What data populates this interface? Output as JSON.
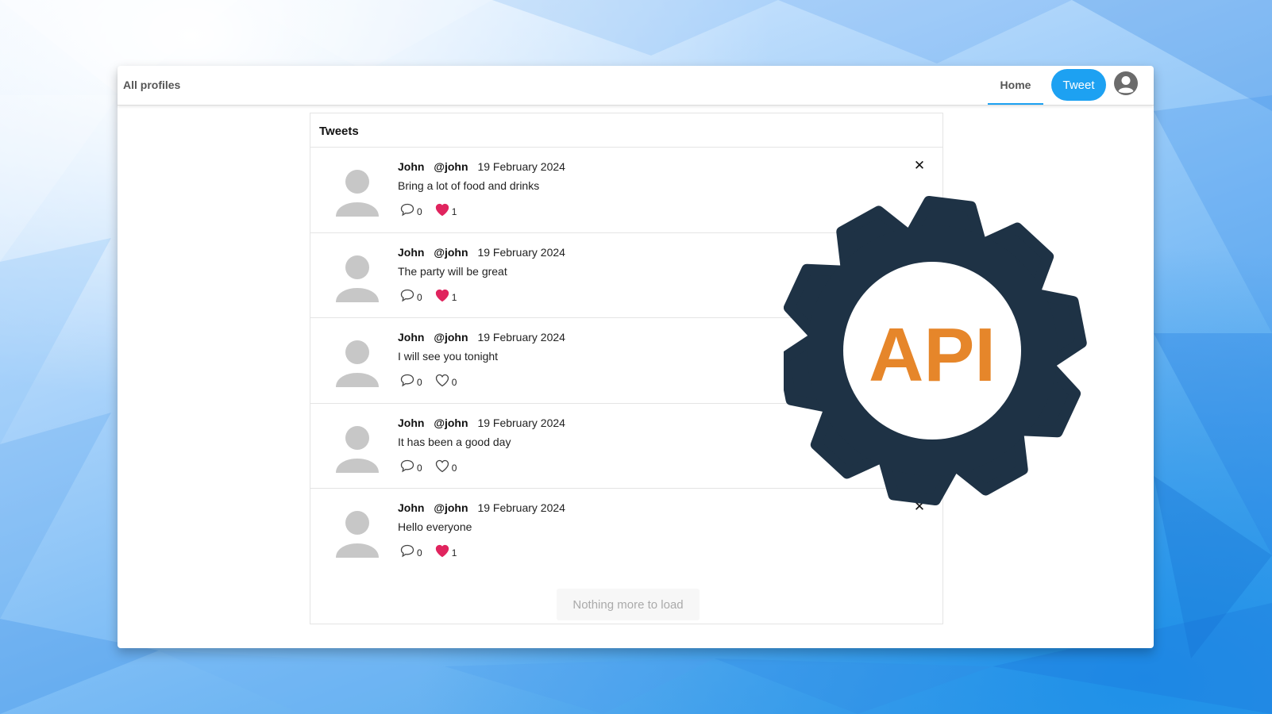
{
  "navbar": {
    "all_profiles": "All profiles",
    "home": "Home",
    "tweet_button": "Tweet",
    "avatar_icon": "user-circle-icon"
  },
  "feed": {
    "title": "Tweets",
    "load_more": "Nothing more to load",
    "tweets": [
      {
        "name": "John",
        "handle": "@john",
        "date": "19 February 2024",
        "text": "Bring a lot of food and drinks",
        "comments": "0",
        "likes": "1",
        "liked": true,
        "deletable": true
      },
      {
        "name": "John",
        "handle": "@john",
        "date": "19 February 2024",
        "text": "The party will be great",
        "comments": "0",
        "likes": "1",
        "liked": true,
        "deletable": false
      },
      {
        "name": "John",
        "handle": "@john",
        "date": "19 February 2024",
        "text": "I will see you tonight",
        "comments": "0",
        "likes": "0",
        "liked": false,
        "deletable": false
      },
      {
        "name": "John",
        "handle": "@john",
        "date": "19 February 2024",
        "text": "It has been a good day",
        "comments": "0",
        "likes": "0",
        "liked": false,
        "deletable": false
      },
      {
        "name": "John",
        "handle": "@john",
        "date": "19 February 2024",
        "text": "Hello everyone",
        "comments": "0",
        "likes": "1",
        "liked": true,
        "deletable": true
      }
    ],
    "delete_glyph": "✕"
  },
  "overlay": {
    "gear_text": "API",
    "gear_color": "#1e3245",
    "text_color": "#e6862a"
  },
  "colors": {
    "accent": "#1da1f2",
    "like_active": "#e0245e"
  }
}
